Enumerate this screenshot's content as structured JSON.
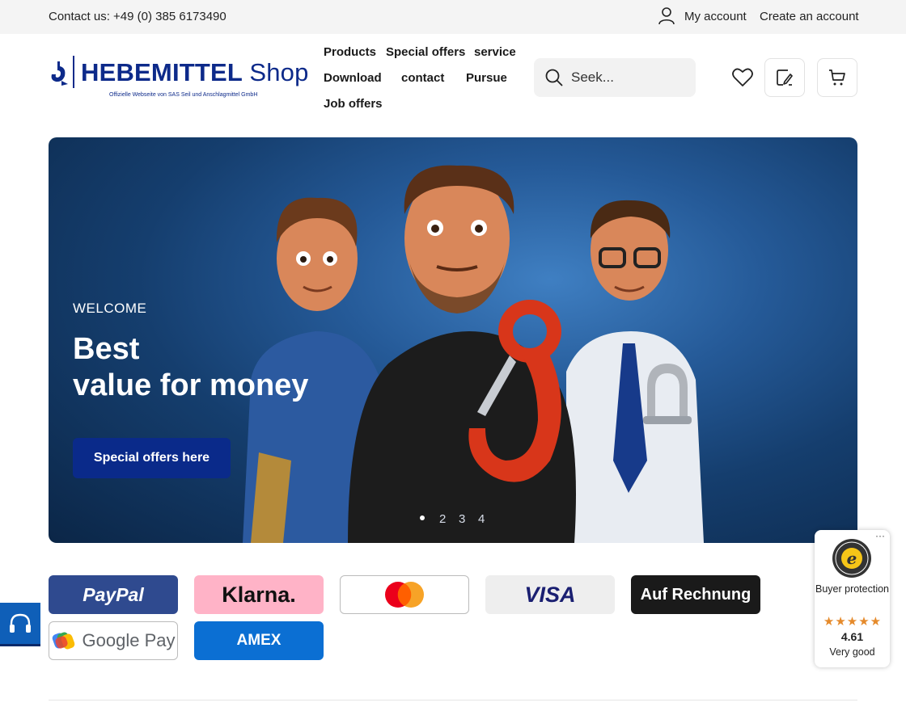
{
  "topbar": {
    "contact": "Contact us: +49 (0) 385 6173490",
    "my_account": "My account",
    "create_account": "Create an account"
  },
  "header": {
    "logo_brand": "HEBEMITTEL",
    "logo_shop": "Shop",
    "logo_tagline": "Offizielle Webseite von SAS Seil und Anschlagmittel GmbH",
    "nav": {
      "products": "Products",
      "special_offers": "Special offers",
      "service": "service",
      "download": "Download",
      "contact": "contact",
      "pursue": "Pursue",
      "job_offers": "Job offers"
    },
    "search_placeholder": "Seek..."
  },
  "hero": {
    "welcome": "WELCOME",
    "headline_line1": "Best",
    "headline_line2": "value for money",
    "cta": "Special offers here",
    "slides": [
      "2",
      "3",
      "4"
    ],
    "active_slide": 1
  },
  "payments": {
    "paypal": "PayPal",
    "klarna": "Klarna.",
    "visa": "VISA",
    "invoice": "Auf Rechnung",
    "google_pay": "Google Pay",
    "amex": "AMEX"
  },
  "trust_badge": {
    "label": "Buyer protection",
    "stars": "★★★★★",
    "score": "4.61",
    "rating": "Very good"
  },
  "colors": {
    "brand_blue": "#0d2a8a",
    "cta_blue": "#0a2a8a",
    "paypal_blue": "#2f4a8f",
    "klarna_pink": "#ffb3c7",
    "amex_blue": "#0b6fd3",
    "star_orange": "#e58a2b"
  },
  "icons": [
    "user-icon",
    "search-icon",
    "heart-icon",
    "edit-icon",
    "cart-icon",
    "headset-icon",
    "mastercard-icon",
    "google-g-icon",
    "trusted-shops-seal-icon"
  ]
}
